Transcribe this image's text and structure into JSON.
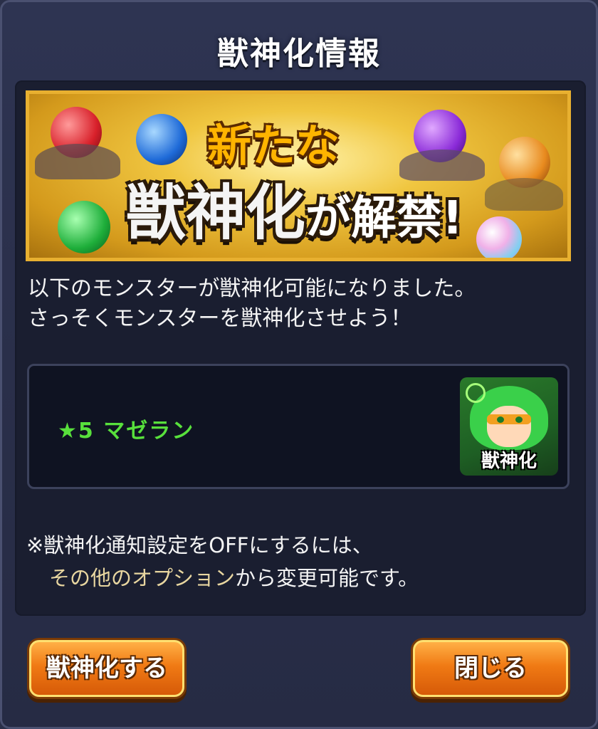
{
  "dialog": {
    "title": "獣神化情報"
  },
  "banner": {
    "line1": "新たな",
    "line2_main": "獣神化",
    "line2_tail": "が解禁!",
    "image_description": "Gold banner with evolution orbs"
  },
  "message": {
    "line1": "以下のモンスターが獣神化可能になりました。",
    "line2": "さっそくモンスターを獣神化させよう！"
  },
  "monster": {
    "name": "★5 マゼラン",
    "icon_label": "獣神化",
    "icon": "character-portrait-icon"
  },
  "note": {
    "line1": "※獣神化通知設定をOFFにするには、",
    "line2_highlight": "その他のオプション",
    "line2_rest": "から変更可能です。"
  },
  "buttons": {
    "evolve_label": "獣神化する",
    "close_label": "閉じる"
  },
  "colors": {
    "panel_bg": "#1a1e30",
    "monster_name": "#58e03c",
    "button_orange": "#f07a14",
    "banner_gold": "#e8b030"
  }
}
